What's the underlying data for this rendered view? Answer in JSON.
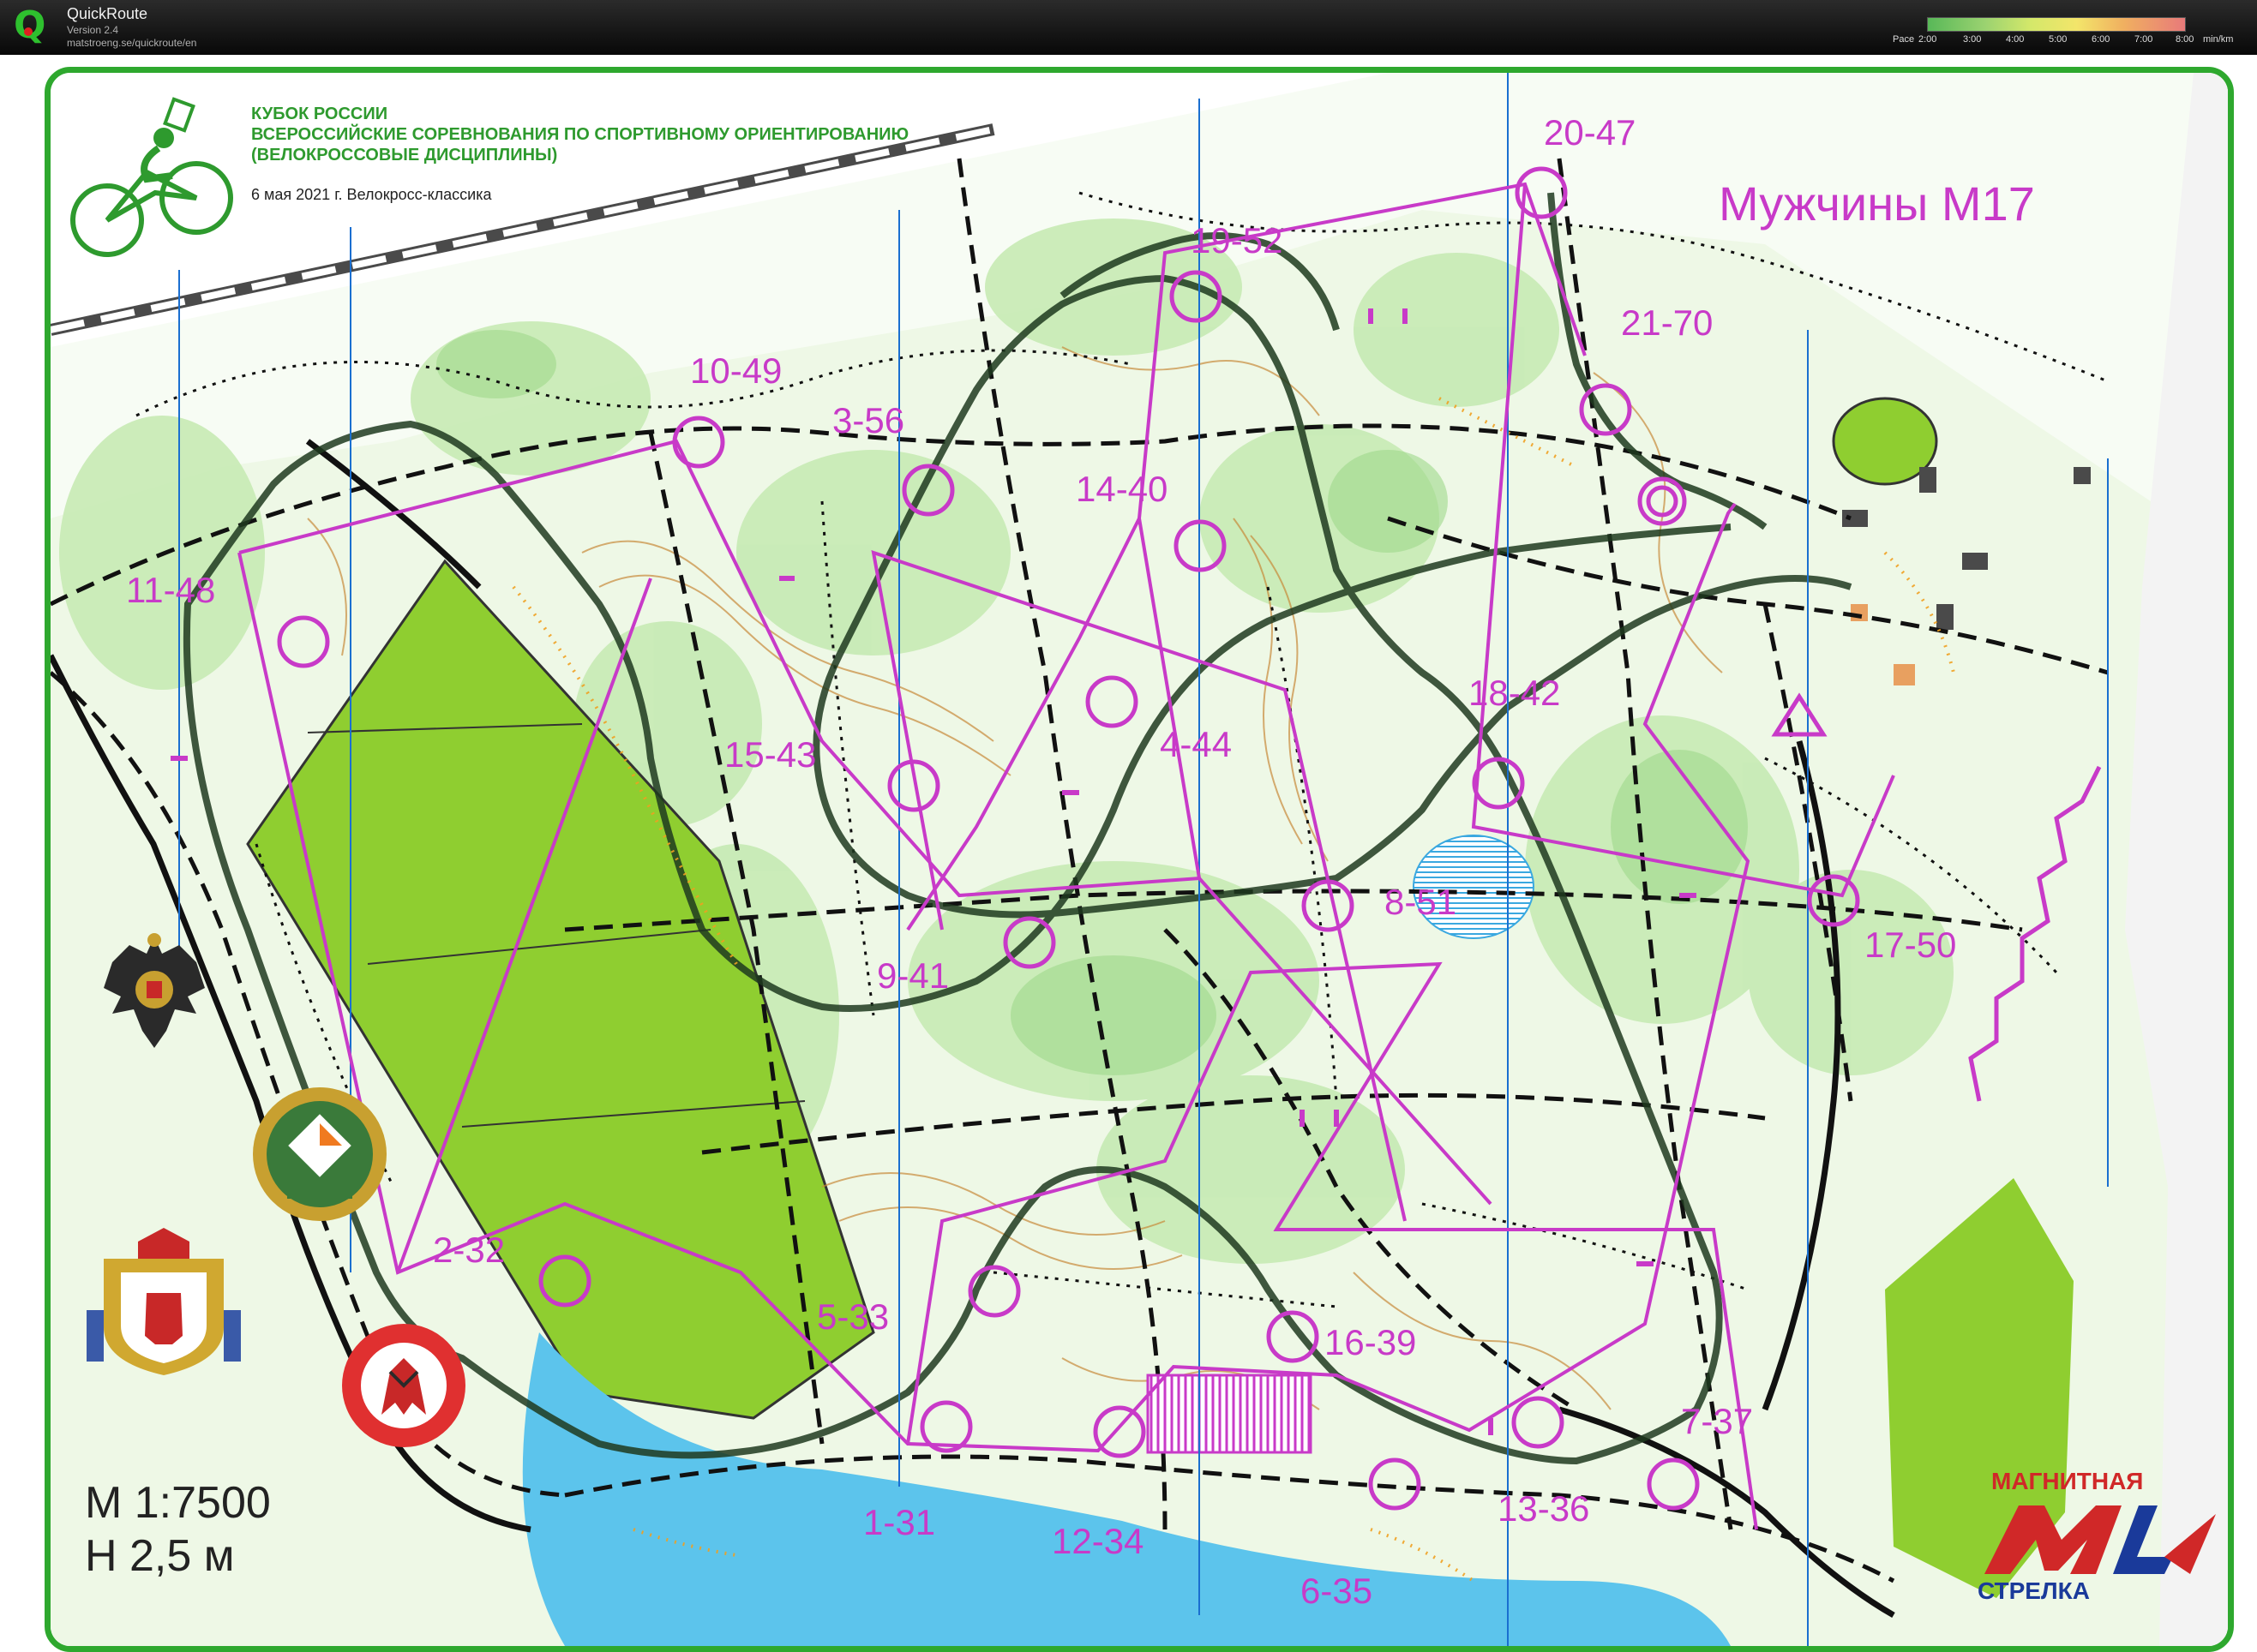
{
  "app": {
    "name": "QuickRoute",
    "version": "Version 2.4",
    "url": "matstroeng.se/quickroute/en"
  },
  "pace_legend": {
    "prefix": "Pace",
    "ticks": [
      "2:00",
      "3:00",
      "4:00",
      "5:00",
      "6:00",
      "7:00",
      "8:00"
    ],
    "unit": "min/km"
  },
  "event": {
    "line1": "КУБОК РОССИИ",
    "line2": "ВСЕРОССИЙСКИЕ СОРЕВНОВАНИЯ ПО СПОРТИВНОМУ ОРИЕНТИРОВАНИЮ",
    "line3": "(ВЕЛОКРОССОВЫЕ ДИСЦИПЛИНЫ)",
    "date_line": "6 мая 2021 г. Велокросс-классика"
  },
  "class_title": "Мужчины М17",
  "controls": [
    {
      "id": "c1",
      "label": "1-31"
    },
    {
      "id": "c2",
      "label": "2-32"
    },
    {
      "id": "c3",
      "label": "3-56"
    },
    {
      "id": "c4",
      "label": "4-44"
    },
    {
      "id": "c5",
      "label": "5-33"
    },
    {
      "id": "c6",
      "label": "6-35"
    },
    {
      "id": "c7",
      "label": "7-37"
    },
    {
      "id": "c8",
      "label": "8-51"
    },
    {
      "id": "c9",
      "label": "9-41"
    },
    {
      "id": "c10",
      "label": "10-49"
    },
    {
      "id": "c11",
      "label": "11-48"
    },
    {
      "id": "c12",
      "label": "12-34"
    },
    {
      "id": "c13",
      "label": "13-36"
    },
    {
      "id": "c14",
      "label": "14-40"
    },
    {
      "id": "c15",
      "label": "15-43"
    },
    {
      "id": "c16",
      "label": "16-39"
    },
    {
      "id": "c17",
      "label": "17-50"
    },
    {
      "id": "c18",
      "label": "18-42"
    },
    {
      "id": "c19",
      "label": "19-52"
    },
    {
      "id": "c20",
      "label": "20-47"
    },
    {
      "id": "c21",
      "label": "21-70"
    }
  ],
  "scale": {
    "line1": "М 1:7500",
    "line2": "Н 2,5 м"
  },
  "sponsor": {
    "top": "МАГНИТНАЯ",
    "bottom": "СТРЕЛКА"
  },
  "colors": {
    "course": "#c83ac8",
    "frame": "#2ea82e",
    "field": "#8fce30",
    "water": "#5cc4ec",
    "forest": "#d4efc4",
    "track": "#1e3a1e"
  }
}
